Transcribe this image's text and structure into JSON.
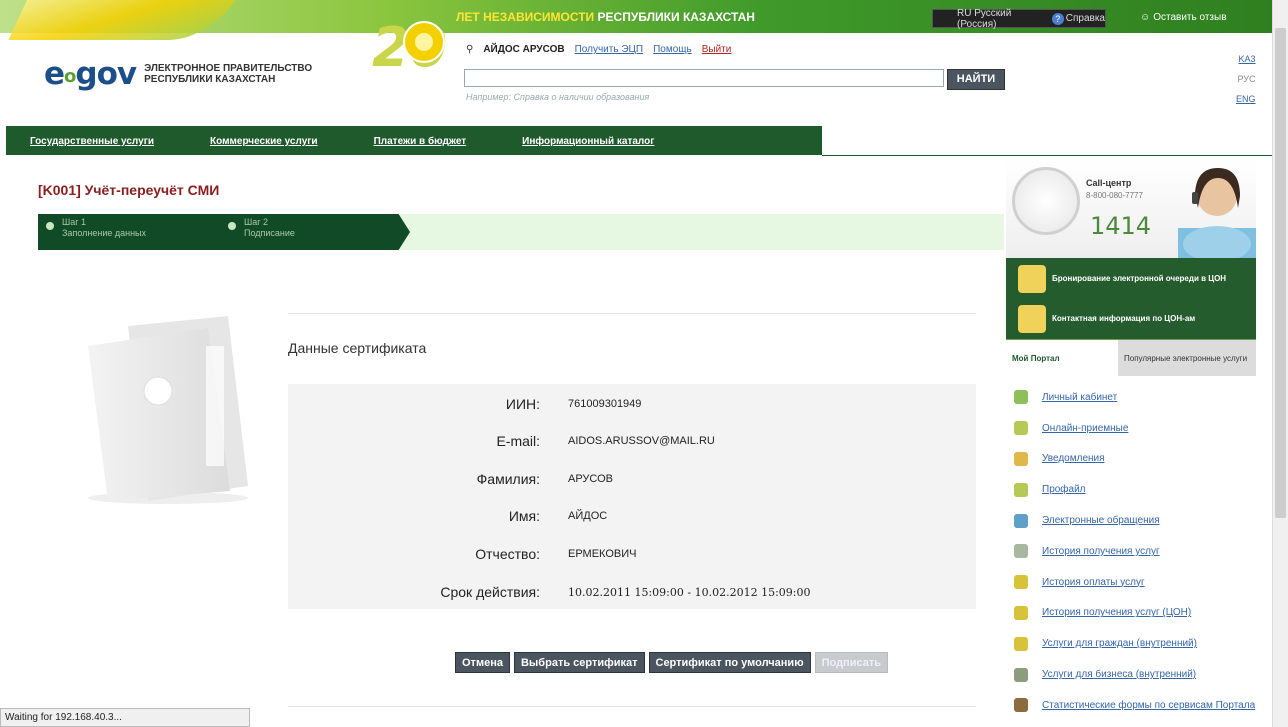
{
  "banner": {
    "text_highlight": "ЛЕТ НЕЗАВИСИМОСТИ",
    "text_rest": " РЕСПУБЛИКИ КАЗАХСТАН",
    "jubilee_number": "20"
  },
  "top_right": {
    "language": "RU Русский (Россия)",
    "help": "Справка",
    "help_icon": "?",
    "feedback": "Оставить отзыв"
  },
  "logo": {
    "mark_e": "e",
    "mark_o": "o",
    "mark_gov": "gov",
    "text": "ЭЛЕКТРОННОЕ ПРАВИТЕЛЬСТВО РЕСПУБЛИКИ КАЗАХСТАН"
  },
  "user_bar": {
    "user_name": "АЙДОС АРУСОВ",
    "get_signature": "Получить ЭЦП",
    "help": "Помощь",
    "exit": "Выйти"
  },
  "search": {
    "value": "",
    "hint": "Например: Справка о наличии образования",
    "button": "НАЙТИ"
  },
  "languages": [
    {
      "label": "KA3",
      "current": false
    },
    {
      "label": "РУС",
      "current": true
    },
    {
      "label": "ENG",
      "current": false
    }
  ],
  "nav": [
    "Государственные услуги",
    "Коммерческие услуги",
    "Платежи в бюджет",
    "Информационный каталог"
  ],
  "page_title": "[K001] Учёт-переучёт СМИ",
  "steps": [
    {
      "num": "Шаг 1",
      "label": "Заполнение данных"
    },
    {
      "num": "Шаг 2",
      "label": "Подписание"
    }
  ],
  "certificate": {
    "title": "Данные сертификата",
    "rows": [
      {
        "label": "ИИН:",
        "value": "761009301949"
      },
      {
        "label": "E-mail:",
        "value": "AIDOS.ARUSSOV@MAIL.RU"
      },
      {
        "label": "Фамилия:",
        "value": "АРУСОВ"
      },
      {
        "label": "Имя:",
        "value": "АЙДОС"
      },
      {
        "label": "Отчество:",
        "value": "ЕРМЕКОВИЧ"
      },
      {
        "label": "Срок действия:",
        "value": "10.02.2011 15:09:00 - 10.02.2012 15:09:00"
      }
    ]
  },
  "buttons": {
    "cancel": "Отмена",
    "choose_cert": "Выбрать сертификат",
    "default_cert": "Сертификат по умолчанию",
    "sign": "Подписать"
  },
  "call_center": {
    "label": "Call-центр",
    "phone": "8-800-080-7777",
    "short": "1414"
  },
  "side_banners": [
    "Бронирование электронной очереди в ЦОН",
    "Контактная информация по ЦОН-ам"
  ],
  "tabs": {
    "my_portal": "Мой Портал",
    "popular": "Популярные электронные услуги"
  },
  "menu": [
    {
      "label": "Личный кабинет",
      "color": "#8fbf5a"
    },
    {
      "label": "Онлайн-приемные",
      "color": "#b5c957"
    },
    {
      "label": "Уведомления",
      "color": "#e0b84a"
    },
    {
      "label": "Профайл",
      "color": "#b5c957"
    },
    {
      "label": "Электронные обращения",
      "color": "#5fa0c8"
    },
    {
      "label": "История получения услуг",
      "color": "#a8b8a0"
    },
    {
      "label": "История оплаты услуг",
      "color": "#d8c23a"
    },
    {
      "label": "История получения услуг (ЦОН)",
      "color": "#d8c23a"
    },
    {
      "label": "Услуги для граждан (внутренний)",
      "color": "#d8c23a"
    },
    {
      "label": "Услуги для бизнеса (внутренний)",
      "color": "#8c9c7c"
    },
    {
      "label": "Статистические формы по сервисам Портала",
      "color": "#8c6c3c"
    }
  ],
  "status_bar": "Waiting for 192.168.40.3..."
}
